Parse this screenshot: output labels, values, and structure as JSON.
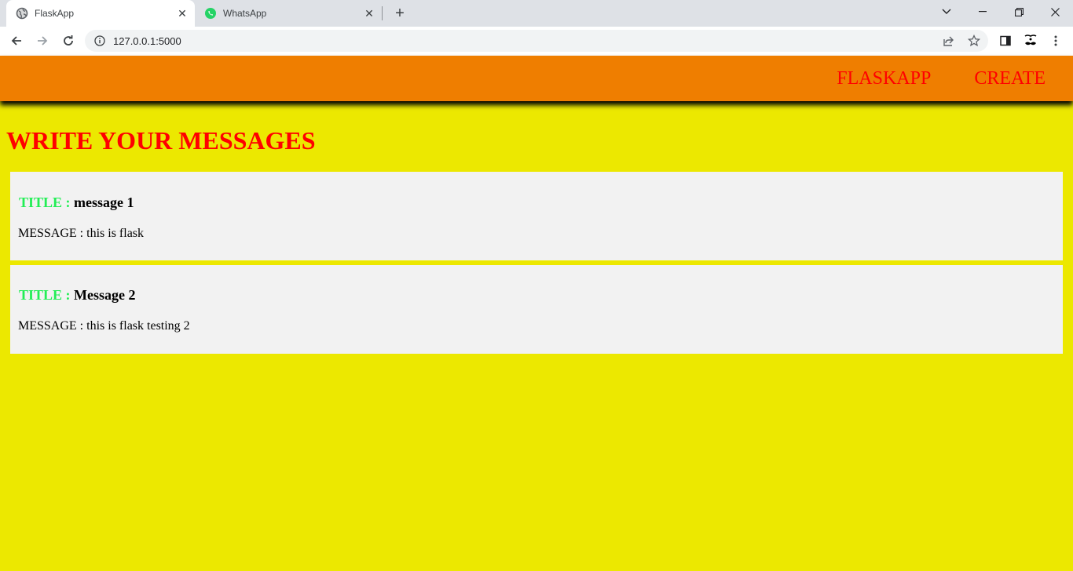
{
  "browser": {
    "tabs": [
      {
        "title": "FlaskApp",
        "active": true,
        "icon": "globe-icon"
      },
      {
        "title": "WhatsApp",
        "active": false,
        "icon": "whatsapp-icon"
      }
    ],
    "url": "127.0.0.1:5000"
  },
  "navbar": {
    "links": [
      "FLASKAPP",
      "CREATE"
    ],
    "color": "#ef7e00",
    "link_color": "#ff0000"
  },
  "page": {
    "background": "#ece800",
    "heading": "WRITE YOUR MESSAGES",
    "title_label": "TITLE :",
    "message_label": "MESSAGE :",
    "messages": [
      {
        "title": "message 1",
        "message": "this is flask"
      },
      {
        "title": "Message 2",
        "message": "this is flask testing 2"
      }
    ]
  }
}
